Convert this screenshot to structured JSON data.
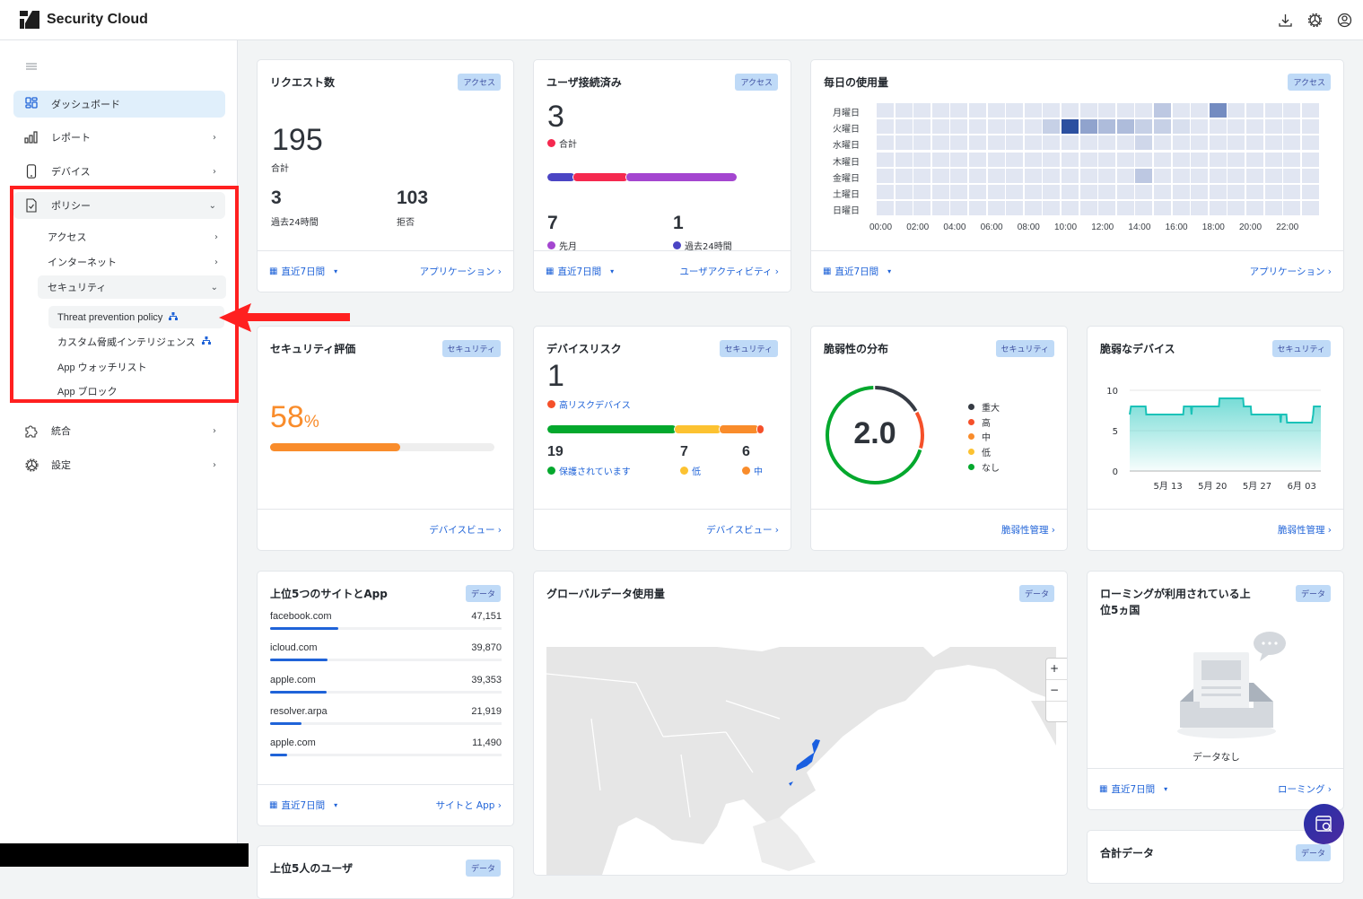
{
  "app": {
    "title": "Security Cloud"
  },
  "topbar": {
    "icons": [
      "download-icon",
      "gear-icon",
      "user-icon"
    ]
  },
  "sidebar": {
    "items": [
      {
        "label": "ダッシュボード",
        "icon": "dashboard-icon",
        "active": true
      },
      {
        "label": "レポート",
        "icon": "bar-chart-icon",
        "chevron": "›"
      },
      {
        "label": "デバイス",
        "icon": "phone-icon",
        "chevron": "›"
      },
      {
        "label": "ポリシー",
        "icon": "policy-doc-icon",
        "chevron": "⌄",
        "expanded": true
      },
      {
        "label": "統合",
        "icon": "puzzle-icon",
        "chevron": "›"
      },
      {
        "label": "設定",
        "icon": "gear-icon",
        "chevron": "›"
      }
    ],
    "policy_sub": [
      {
        "label": "アクセス",
        "chevron": "›"
      },
      {
        "label": "インターネット",
        "chevron": "›"
      },
      {
        "label": "セキュリティ",
        "chevron": "⌄",
        "expanded": true
      }
    ],
    "security_leaves": [
      {
        "label": "Threat prevention policy",
        "org_icon": "ꝏ",
        "highlighted": true
      },
      {
        "label": "カスタム脅威インテリジェンス",
        "org_icon": "ꝏ"
      },
      {
        "label": "App ウォッチリスト"
      },
      {
        "label": "App ブロック"
      }
    ]
  },
  "common": {
    "range_label": "直近7日間",
    "cal_glyph": "▦",
    "caret": "▾",
    "link_chevron": "›"
  },
  "cards": {
    "requests": {
      "title": "リクエスト数",
      "badge": "アクセス",
      "total": "195",
      "total_label": "合計",
      "last24": "3",
      "last24_label": "過去24時間",
      "denied": "103",
      "denied_label": "拒否",
      "link": "アプリケーション"
    },
    "users": {
      "title": "ユーザ接続済み",
      "badge": "アクセス",
      "total": "3",
      "total_label": "合計",
      "last_month": "7",
      "last_month_label": "先月",
      "last24": "1",
      "last24_label": "過去24時間",
      "bar_segments": [
        {
          "name": "過去24時間",
          "value": 1,
          "color": "#4b45c4"
        },
        {
          "name": "合計",
          "value": 2,
          "color": "#f5294f"
        },
        {
          "name": "先月",
          "value": 4,
          "color": "#a446d0"
        }
      ],
      "link": "ユーザアクティビティ"
    },
    "daily_usage": {
      "title": "毎日の使用量",
      "badge": "アクセス",
      "link": "アプリケーション"
    },
    "security_score": {
      "title": "セキュリティ評価",
      "badge": "セキュリティ",
      "value": "58",
      "unit": "%",
      "progress": 0.58,
      "color": "#f98c2b",
      "link": "デバイスビュー"
    },
    "device_risk": {
      "title": "デバイスリスク",
      "badge": "セキュリティ",
      "high_risk": "1",
      "high_risk_label": "高リスクデバイス",
      "segments": [
        {
          "name": "保護されています",
          "value": 19,
          "color": "#04a82d"
        },
        {
          "name": "低",
          "value": 7,
          "color": "#fcc231"
        },
        {
          "name": "中",
          "value": 6,
          "color": "#f98c2b"
        },
        {
          "name": "高",
          "value": 1,
          "color": "#f5502a"
        }
      ],
      "protected": "19",
      "protected_label": "保護されています",
      "low": "7",
      "low_label": "低",
      "medium": "6",
      "medium_label": "中",
      "link": "デバイスビュー"
    },
    "vuln_dist": {
      "title": "脆弱性の分布",
      "badge": "セキュリティ",
      "score": "2.0",
      "legend": [
        {
          "label": "重大",
          "color": "#363b44",
          "share": 0.17
        },
        {
          "label": "高",
          "color": "#f5502a",
          "share": 0.13
        },
        {
          "label": "中",
          "color": "#f98c2b",
          "share": 0
        },
        {
          "label": "低",
          "color": "#fcc231",
          "share": 0
        },
        {
          "label": "なし",
          "color": "#04a82d",
          "share": 0.7
        }
      ],
      "link": "脆弱性管理"
    },
    "vuln_devices": {
      "title": "脆弱なデバイス",
      "badge": "セキュリティ",
      "link": "脆弱性管理"
    },
    "top_sites": {
      "title": "上位5つのサイトとApp",
      "badge": "データ",
      "rows": [
        {
          "name": "facebook.com",
          "value": "47,151",
          "n": 47151
        },
        {
          "name": "icloud.com",
          "value": "39,870",
          "n": 39870
        },
        {
          "name": "apple.com",
          "value": "39,353",
          "n": 39353
        },
        {
          "name": "resolver.arpa",
          "value": "21,919",
          "n": 21919
        },
        {
          "name": "apple.com",
          "value": "11,490",
          "n": 11490
        }
      ],
      "link": "サイトと App"
    },
    "global_usage": {
      "title": "グローバルデータ使用量",
      "badge": "データ",
      "highlighted_country": "Japan",
      "zoom_in": "+",
      "zoom_out": "−"
    },
    "roaming": {
      "title": "ローミングが利用されている上位5ヵ国",
      "badge": "データ",
      "empty": "データなし",
      "link": "ローミング"
    },
    "total_data": {
      "title": "合計データ",
      "badge": "データ"
    },
    "top_users": {
      "title": "上位5人のユーザ",
      "badge": "データ"
    }
  },
  "chart_data": [
    {
      "type": "heatmap",
      "title": "毎日の使用量",
      "rows": [
        "月曜日",
        "火曜日",
        "水曜日",
        "木曜日",
        "金曜日",
        "土曜日",
        "日曜日"
      ],
      "x_tick_labels": [
        "00:00",
        "02:00",
        "04:00",
        "06:00",
        "08:00",
        "10:00",
        "12:00",
        "14:00",
        "16:00",
        "18:00",
        "20:00",
        "22:00"
      ],
      "columns": 24,
      "intensity_scale": [
        0,
        1
      ],
      "values": [
        [
          0,
          0,
          0,
          0,
          0,
          0,
          0,
          0,
          0,
          0,
          0,
          0,
          0,
          0,
          0,
          0.2,
          0,
          0,
          0.6,
          0,
          0,
          0,
          0,
          0
        ],
        [
          0,
          0,
          0,
          0,
          0,
          0,
          0,
          0,
          0,
          0.15,
          1,
          0.45,
          0.28,
          0.28,
          0.15,
          0.15,
          0.05,
          0,
          0,
          0,
          0,
          0,
          0,
          0
        ],
        [
          0,
          0,
          0,
          0,
          0,
          0,
          0,
          0,
          0,
          0,
          0,
          0,
          0,
          0,
          0.1,
          0,
          0,
          0,
          0,
          0,
          0,
          0,
          0,
          0
        ],
        [
          0,
          0,
          0,
          0,
          0,
          0,
          0,
          0,
          0,
          0,
          0,
          0,
          0,
          0,
          0,
          0,
          0,
          0,
          0,
          0,
          0,
          0,
          0,
          0
        ],
        [
          0,
          0,
          0,
          0,
          0,
          0,
          0,
          0,
          0,
          0,
          0,
          0,
          0,
          0,
          0.2,
          0,
          0,
          0,
          0,
          0,
          0,
          0,
          0,
          0
        ],
        [
          0,
          0,
          0,
          0,
          0,
          0,
          0,
          0,
          0,
          0,
          0,
          0,
          0,
          0,
          0,
          0,
          0,
          0,
          0,
          0,
          0,
          0,
          0,
          0
        ],
        [
          0,
          0,
          0,
          0,
          0,
          0,
          0,
          0,
          0,
          0,
          0,
          0,
          0,
          0,
          0,
          0,
          0,
          0,
          0,
          0,
          0,
          0,
          0,
          0
        ]
      ]
    },
    {
      "type": "area",
      "title": "脆弱なデバイス",
      "ylim": [
        0,
        10
      ],
      "y_ticks": [
        0,
        5,
        10
      ],
      "x_tick_labels": [
        "5月 13",
        "5月 20",
        "5月 27",
        "6月 03"
      ],
      "x_range_days": [
        0,
        30
      ],
      "x_ticks_days": [
        6,
        13,
        20,
        27
      ],
      "grid": true,
      "series": [
        {
          "name": "脆弱なデバイス",
          "color": "#1bc2b8",
          "points": [
            [
              0,
              7
            ],
            [
              0.2,
              8
            ],
            [
              2.5,
              8
            ],
            [
              2.6,
              7
            ],
            [
              8.4,
              7
            ],
            [
              8.5,
              8
            ],
            [
              9.6,
              8
            ],
            [
              9.7,
              7
            ],
            [
              9.8,
              8
            ],
            [
              14,
              8
            ],
            [
              14.1,
              9
            ],
            [
              17.8,
              9
            ],
            [
              17.9,
              8
            ],
            [
              19,
              8
            ],
            [
              19.1,
              7
            ],
            [
              23.6,
              7
            ],
            [
              23.7,
              6
            ],
            [
              23.8,
              7
            ],
            [
              24.6,
              7
            ],
            [
              24.7,
              6
            ],
            [
              28.6,
              6
            ],
            [
              28.8,
              7
            ],
            [
              28.9,
              8
            ],
            [
              30,
              8
            ]
          ]
        }
      ]
    }
  ]
}
